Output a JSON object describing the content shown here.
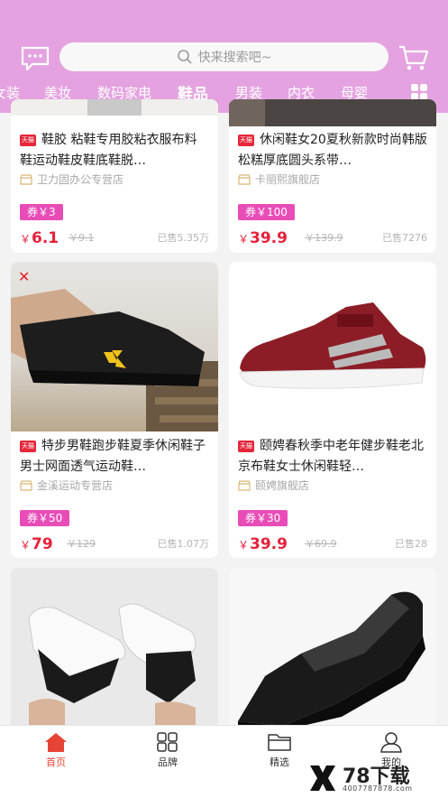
{
  "search": {
    "placeholder": "快来搜索吧~"
  },
  "categories": [
    "女装",
    "美妆",
    "数码家电",
    "鞋品",
    "男装",
    "内衣",
    "母婴"
  ],
  "active_category": "鞋品",
  "products": [
    {
      "title": "鞋胶 粘鞋专用胶粘衣服布料鞋运动鞋皮鞋底鞋脱…",
      "badge": "天猫",
      "shop": "卫力固办公专营店",
      "coupon": "券￥3",
      "price": "6.1",
      "original": "￥9.1",
      "sold": "已售5.35万"
    },
    {
      "title": "休闲鞋女20夏秋新款时尚韩版松糕厚底圆头系带…",
      "badge": "天猫",
      "shop": "卡丽熙旗舰店",
      "coupon": "券￥100",
      "price": "39.9",
      "original": "￥139.9",
      "sold": "已售7276"
    },
    {
      "title": "特步男鞋跑步鞋夏季休闲鞋子男士网面透气运动鞋…",
      "badge": "天猫",
      "shop": "金溪运动专营店",
      "coupon": "券￥50",
      "price": "79",
      "original": "￥129",
      "sold": "已售1.07万"
    },
    {
      "title": "颐娉春秋季中老年健步鞋老北京布鞋女士休闲鞋轻…",
      "badge": "天猫",
      "shop": "颐娉旗舰店",
      "coupon": "券￥30",
      "price": "39.9",
      "original": "￥69.9",
      "sold": "已售28"
    }
  ],
  "tabbar": [
    {
      "label": "首页",
      "icon": "home-icon"
    },
    {
      "label": "品牌",
      "icon": "brand-grid-icon"
    },
    {
      "label": "精选",
      "icon": "folder-icon"
    },
    {
      "label": "我的",
      "icon": "user-icon"
    }
  ],
  "watermark": {
    "text": "78下载",
    "url": "4007787878.com"
  },
  "colors": {
    "header": "#e4a3e0",
    "price": "#e5213a",
    "coupon": "#e84db7",
    "active_tab": "#e64434"
  }
}
